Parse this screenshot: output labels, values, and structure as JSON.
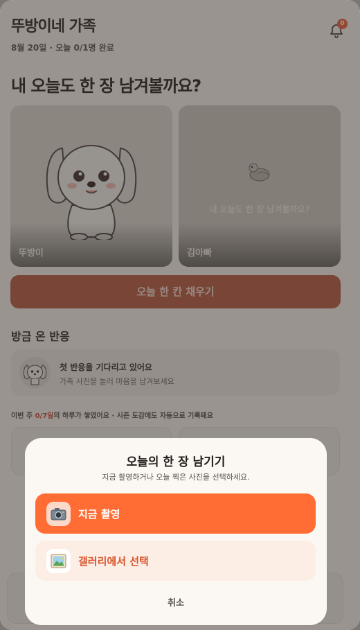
{
  "header": {
    "family_title": "뚜방이네 가족",
    "subline": "8월 20일 · 오늘 0/1명 완료",
    "notification_count": "0"
  },
  "question": "내 오늘도 한 장 남겨볼까요?",
  "cards": [
    {
      "name": "뚜방이",
      "hint": ""
    },
    {
      "name": "김아빠",
      "hint": "내 오늘도 한 장 남겨볼까요?"
    }
  ],
  "fill_button": "오늘 한 칸 채우기",
  "reactions": {
    "section_title": "방금 온 반응",
    "title": "첫 반응을 기다리고 있어요",
    "subtitle": "가족 사진을 눌러 마음을 남겨보세요"
  },
  "week": {
    "prefix": "이번 주 ",
    "count": "0/7일",
    "suffix": "의 하루가 쌓였어요 · 시즌 도감에도 자동으로 기록돼요"
  },
  "sheet": {
    "title": "오늘의 한 장 남기기",
    "subtitle": "지금 촬영하거나 오늘 찍은 사진을 선택하세요.",
    "camera_label": "지금 촬영",
    "camera_icon": "camera-icon",
    "gallery_label": "갤러리에서 선택",
    "gallery_icon": "picture-icon",
    "cancel_label": "취소"
  },
  "colors": {
    "accent": "#ff6d35",
    "accent_dim": "#b6563e",
    "highlight": "#c6492c",
    "background": "#f8f4f0"
  }
}
